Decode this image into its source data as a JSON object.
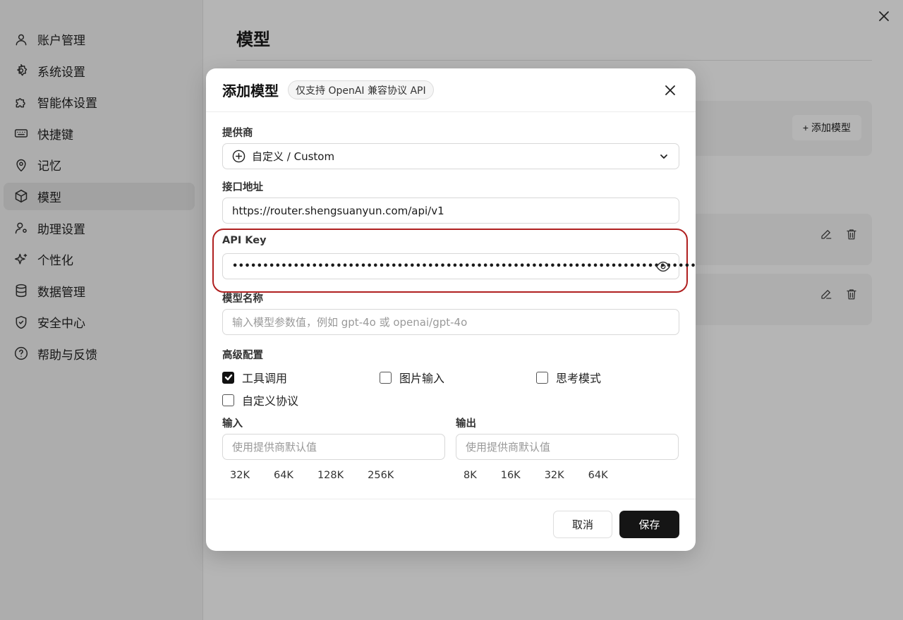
{
  "sidebar": {
    "items": [
      {
        "label": "账户管理",
        "icon": "user-icon"
      },
      {
        "label": "系统设置",
        "icon": "gear-icon"
      },
      {
        "label": "智能体设置",
        "icon": "puzzle-icon"
      },
      {
        "label": "快捷键",
        "icon": "keyboard-icon"
      },
      {
        "label": "记忆",
        "icon": "brain-pin-icon"
      },
      {
        "label": "模型",
        "icon": "cube-icon",
        "active": true
      },
      {
        "label": "助理设置",
        "icon": "user-gear-icon"
      },
      {
        "label": "个性化",
        "icon": "sparkle-icon"
      },
      {
        "label": "数据管理",
        "icon": "database-icon"
      },
      {
        "label": "安全中心",
        "icon": "shield-icon"
      },
      {
        "label": "帮助与反馈",
        "icon": "help-circle-icon"
      }
    ]
  },
  "main": {
    "title": "模型",
    "add_model_button": "+ 添加模型"
  },
  "modal": {
    "title": "添加模型",
    "badge": "仅支持 OpenAI 兼容协议 API",
    "provider": {
      "label": "提供商",
      "value": "自定义 / Custom"
    },
    "endpoint": {
      "label": "接口地址",
      "value": "https://router.shengsuanyun.com/api/v1"
    },
    "api_key": {
      "label": "API Key",
      "masked_value": "••••••••••••••••••••••••••••••••••••••••••••••••••••••••••••••••••••••••••••"
    },
    "model_name": {
      "label": "模型名称",
      "placeholder": "输入模型参数值，例如 gpt-4o 或 openai/gpt-4o"
    },
    "advanced": {
      "label": "高级配置",
      "options": [
        {
          "label": "工具调用",
          "checked": true
        },
        {
          "label": "图片输入",
          "checked": false
        },
        {
          "label": "思考模式",
          "checked": false
        },
        {
          "label": "自定义协议",
          "checked": false
        }
      ]
    },
    "input": {
      "label": "输入",
      "placeholder": "使用提供商默认值",
      "chips": [
        "32K",
        "64K",
        "128K",
        "256K"
      ]
    },
    "output": {
      "label": "输出",
      "placeholder": "使用提供商默认值",
      "chips": [
        "8K",
        "16K",
        "32K",
        "64K"
      ]
    },
    "cancel": "取消",
    "save": "保存"
  }
}
